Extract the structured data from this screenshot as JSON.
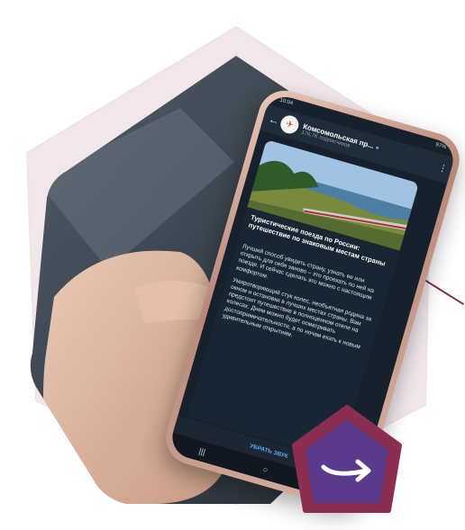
{
  "colors": {
    "backdrop": "#f1e7ea",
    "accent": "#7b2e4f",
    "button_outer": "#8b2f52",
    "button_inner": "#5a3a8a",
    "telegram_link": "#5aa7ea"
  },
  "status_bar": {
    "time": "10:04",
    "battery": "97%"
  },
  "chat_header": {
    "back_icon": "arrow-left-icon",
    "channel_name": "Комсомольская пр...",
    "verified_icon": "verified-badge-icon",
    "subscribers": "176,7K подписчиков",
    "menu_icon": "more-vertical-icon"
  },
  "post": {
    "image_alt": "train-by-lake-photo",
    "title": "Туристические поезда по России: путешествие по знаковым местам страны",
    "paragraphs": [
      "Лучший способ увидеть страну, узнать ее или открыть для себя заново – это проехать по ней на поезде. И сейчас сделать это можно с настоящим комфортом.",
      "Умиротворяющий стук колес, необъятная родина за окном и остановки в лучших местах страны. Вам предстоит путешествие в полноценном отеле на колесах. Днем можно будет осматривать достопримечательности, а по ночам ехать к новым удивительным открытиям."
    ]
  },
  "mute_bar": {
    "label": "УБРАТЬ ЗВУК"
  },
  "nav_bar": {
    "recents": "|||",
    "home": "○",
    "back": "‹"
  },
  "next_button": {
    "icon": "arrow-right-icon"
  }
}
